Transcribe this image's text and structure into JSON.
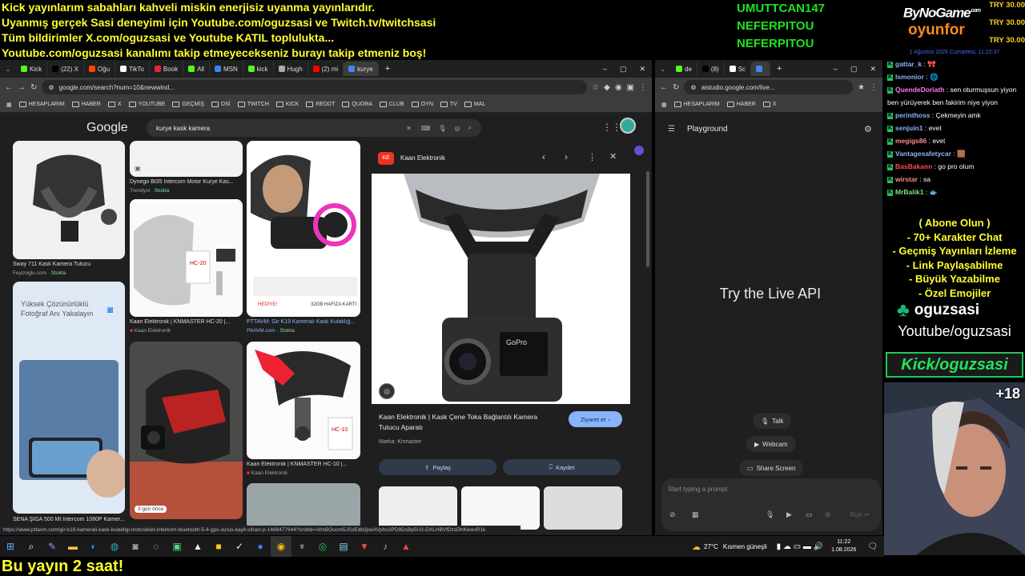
{
  "overlay": {
    "lines": [
      "Kick yayınlarım sabahları kahveli miskin enerjisiz uyanma yayınlarıdır.",
      "Uyanmış gerçek Sasi deneyimi için Youtube.com/oguzsasi ve Twitch.tv/twitchsasi",
      "Tüm bildirimler X.com/oguzsasi ve Youtube KATIL toplulukta...",
      "Youtube.com/oguzsasi kanalımı takip etmeyecekseniz burayı takip etmeniz boş!"
    ],
    "names": [
      "UMUTTCAN147",
      "NEFERPITOU",
      "NEFERPITOU"
    ],
    "sponsor": {
      "brand_top": "ByNoGame",
      "brand_sup": ".com",
      "brand_bottom": "oyunfor",
      "try_values": [
        "TRY 30.00",
        "TRY 30.00",
        "TRY 30.00"
      ]
    },
    "bottom_banner": "Bu yayın 2 saat!",
    "date_line": "1 Ağustos 2026 Cumartesi, 11:22:37",
    "colors": {
      "overlay_yellow": "#ffff2e",
      "names_green": "#1ee21e",
      "kick_green": "#22c55e"
    }
  },
  "chat": {
    "messages": [
      {
        "user": "gattar_k",
        "text": "🎀",
        "color": "#8ab4f8"
      },
      {
        "user": "Ismonior",
        "text": "🌐",
        "color": "#8ab4f8"
      },
      {
        "user": "QuendeDoriath",
        "text": "sen oturmuşsun yiyon ben yürüyerek ben fakirim niye yiyon",
        "color": "#ff7ae0"
      },
      {
        "user": "perinthoss",
        "text": "Çekmeyin amk",
        "color": "#8ab4f8"
      },
      {
        "user": "senjuin1",
        "text": "evet",
        "color": "#8ab4f8"
      },
      {
        "user": "megigs86",
        "text": "evet",
        "color": "#ff8c8c"
      },
      {
        "user": "Vantagesafetycar",
        "text": "🟫",
        "color": "#8ab4f8"
      },
      {
        "user": "BasBakann",
        "text": "go pro olum",
        "color": "#ff4d4d"
      },
      {
        "user": "wirstar",
        "text": "sa",
        "color": "#ff8c8c"
      },
      {
        "user": "MrBalik1",
        "text": "🐟",
        "color": "#7ee07e"
      }
    ],
    "promo": [
      "( Abone Olun )",
      "- 70+ Karakter Chat",
      "- Geçmiş Yayınları İzleme",
      "- Link Paylaşabilme",
      "- Büyük Yazabilme",
      "- Özel Emojiler"
    ],
    "channel": "oguzsasi",
    "youtube": "Youtube/oguzsasi",
    "kick": "Kick/oguzsasi",
    "webcam_badge": "+18"
  },
  "left_browser": {
    "tabs": [
      {
        "label": "Kick",
        "color": "#53fc18"
      },
      {
        "label": "(22) X",
        "color": "#000000"
      },
      {
        "label": "Oğu",
        "color": "#ff4500"
      },
      {
        "label": "TikTo",
        "color": "#ffffff"
      },
      {
        "label": "Book",
        "color": "#e23"
      },
      {
        "label": "All",
        "color": "#53fc18"
      },
      {
        "label": "MSN",
        "color": "#3b82f6"
      },
      {
        "label": "kick",
        "color": "#53fc18"
      },
      {
        "label": "Hugh",
        "color": "#aaaaaa"
      },
      {
        "label": "(2) mi",
        "color": "#ff0000"
      },
      {
        "label": "kurye",
        "color": "#4285f4"
      }
    ],
    "url": "google.com/search?num=10&newwind...",
    "bookmarks": [
      "HESAPLARIM",
      "HABER",
      "X",
      "YOUTUBE",
      "GEÇMİŞ",
      "DSİ",
      "TWITCH",
      "KICK",
      "REDDT",
      "QUORA",
      "CLUB",
      "OYN",
      "TV",
      "MAL"
    ],
    "search_query": "kurye kask kamera",
    "google_logo": "Google",
    "results": [
      {
        "caption": "Sway 711 Kask Kamera Tutucu",
        "source": "Feyizoglu.com",
        "stock": "Stokta"
      },
      {
        "caption": "Dynego Bt35 Intercom Motor Kurye Kas...",
        "source": "Trendyol",
        "stock": "Stokta"
      },
      {
        "caption": "Kaan Elektronik | KNMASTER HC-20 |...",
        "source": "Kaan Elektronik",
        "stock": ""
      },
      {
        "caption": "PTTAVM: Gir K19 Kameralı Kask Kulaklığ...",
        "source": "PttAVM.com",
        "stock": "Stokta"
      },
      {
        "caption": "Kaan Elektronik | KNMASTER HC-10 |...",
        "source": "Kaan Elektronik",
        "stock": ""
      },
      {
        "caption": "SENA ŞİGA 500 Mt Intercom 1080P Kamer...",
        "source": "",
        "stock": ""
      }
    ],
    "promo_card": {
      "line1": "Yüksek Çözünürlüklü",
      "line2": "Fotoğraf Anı Yakalayın"
    },
    "badge_days": "3 gün önce",
    "mini_labels": {
      "hc20": "HC-20",
      "hc10": "HC-10",
      "memory": "32GB HAFIZA KARTI",
      "gift": "HEDİYE!",
      "gopro": "GoPro"
    },
    "panel": {
      "site": "Kaan Elektronik",
      "title": "Kaan Elektronik | Kask Çene Toka Bağlantılı Kamera Tutucu Aparatı",
      "brand": "Marka: Knmaster",
      "visit": "Ziyaret et",
      "share": "Paylaş",
      "save": "Kaydet"
    },
    "status_url": "https://www.pttavm.com/gir-k19-kamerali-kask-kulakligi-motosiklet-interkom-bluetooth-5-4-gps-surus-kayit-cihazi-p-1488477944?srsltid=AfmBOoom5JSxEdb3jseAVpho3PD9DsBp5U2-DXLHBVfDzsDhKewoR1k"
  },
  "right_browser": {
    "tabs": [
      {
        "label": "de",
        "color": "#53fc18"
      },
      {
        "label": "(8)",
        "color": "#000000"
      },
      {
        "label": "Sc",
        "color": "#ffffff"
      },
      {
        "label": "",
        "color": "#4285f4"
      }
    ],
    "url": "aistudio.google.com/live...",
    "bookmarks": [
      "HESAPLARIM",
      "HABER",
      "X"
    ],
    "title": "Playground",
    "center_text": "Try the Live API",
    "buttons": [
      "Talk",
      "Webcam",
      "Share Screen"
    ],
    "prompt_placeholder": "Start typing a prompt",
    "run_label": "Run"
  },
  "taskbar": {
    "weather": "27°C",
    "weather_desc": "Kısmen güneşli",
    "time": "11:22",
    "date": "1.08.2026"
  }
}
